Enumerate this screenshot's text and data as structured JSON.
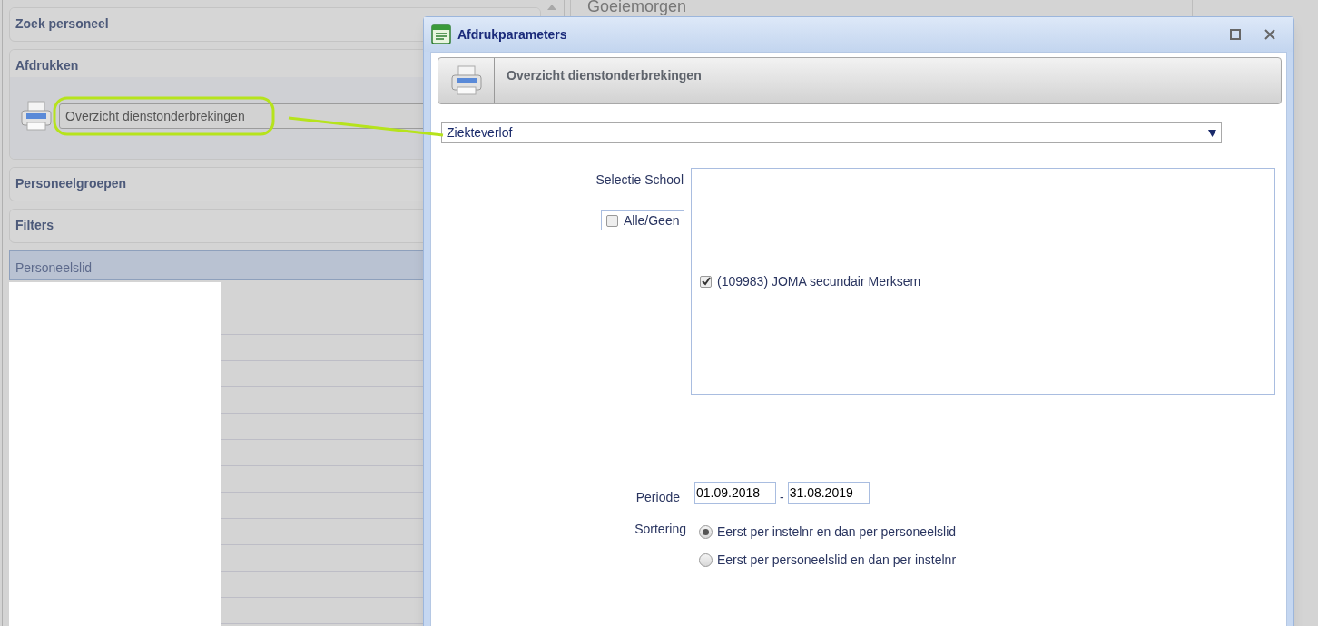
{
  "sidebar": {
    "sections": [
      {
        "title": "Zoek personeel",
        "expanded": false
      },
      {
        "title": "Afdrukken",
        "expanded": true,
        "report_button": "Overzicht dienstonderbrekingen"
      },
      {
        "title": "Personeelgroepen",
        "expanded": false
      },
      {
        "title": "Filters",
        "expanded": false
      }
    ],
    "grid": {
      "header": "Personeelslid"
    }
  },
  "main": {
    "greeting": "Goeiemorgen"
  },
  "dialog": {
    "title": "Afdrukparameters",
    "report_title": "Overzicht dienstonderbrekingen",
    "report_type": {
      "value": "Ziekteverlof"
    },
    "school_selection": {
      "label": "Selectie School",
      "all_none": {
        "label": "Alle/Geen",
        "checked": false
      },
      "schools": [
        {
          "label": "(109983) JOMA secundair Merksem",
          "checked": true
        }
      ]
    },
    "period": {
      "label": "Periode",
      "from": "01.09.2018",
      "separator": "-",
      "to": "31.08.2019"
    },
    "sorting": {
      "label": "Sortering",
      "options": [
        {
          "label": "Eerst per instelnr en dan per personeelslid",
          "selected": true
        },
        {
          "label": "Eerst per personeelslid en dan per instelnr",
          "selected": false
        }
      ]
    }
  }
}
